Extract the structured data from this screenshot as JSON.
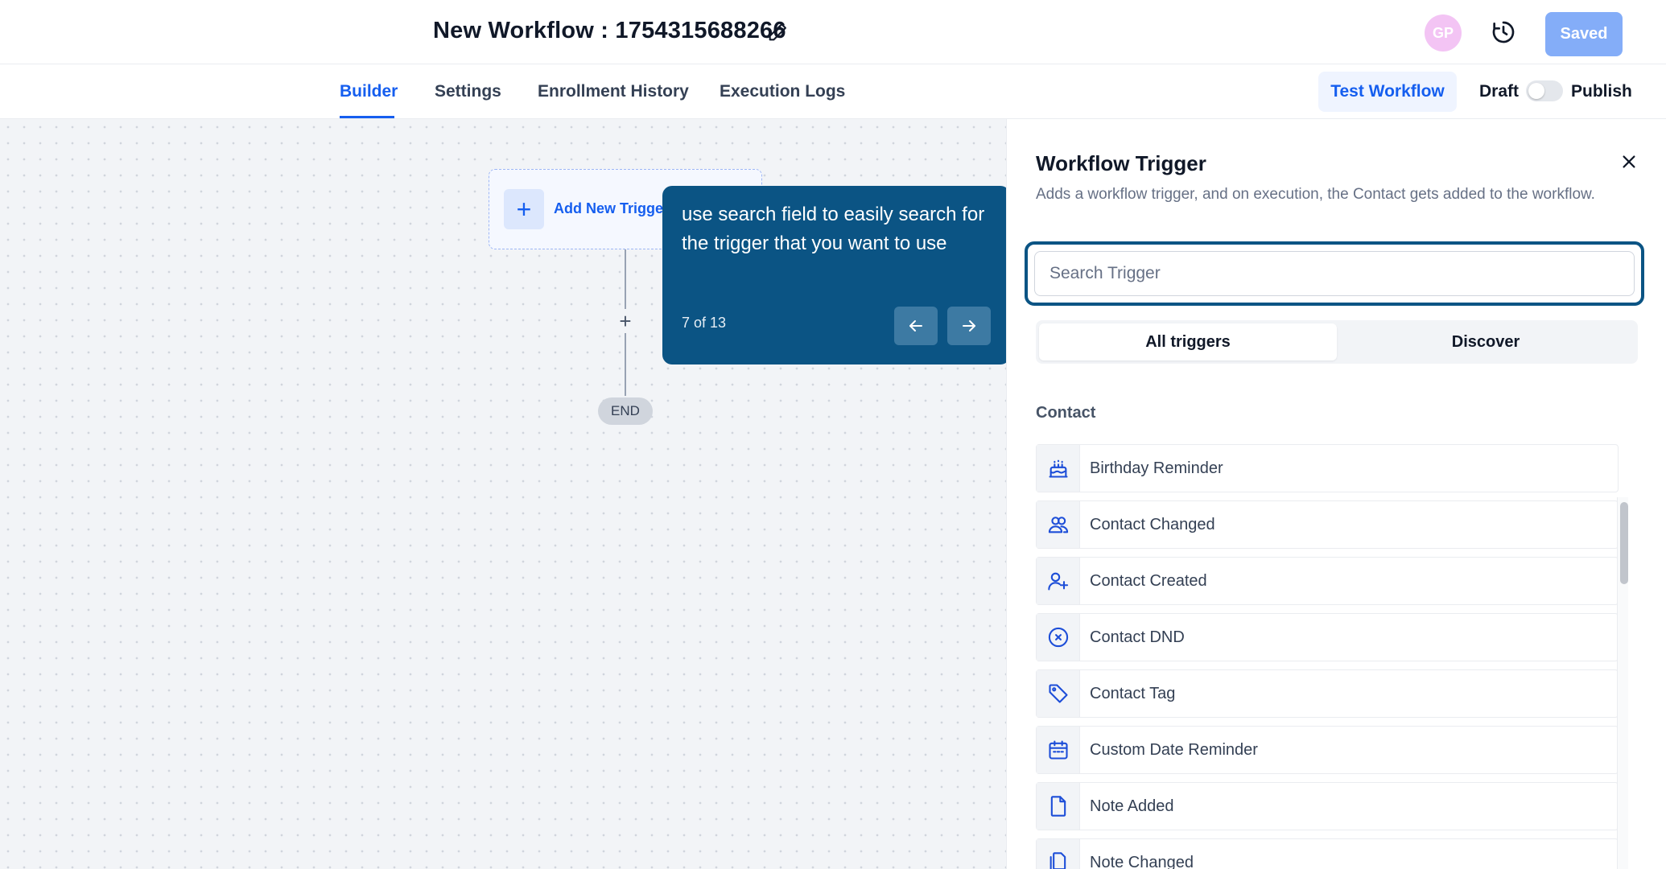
{
  "header": {
    "title": "New Workflow : 1754315688266",
    "avatar_initials": "GP",
    "saved_label": "Saved"
  },
  "tabs": [
    {
      "label": "Builder",
      "active": true
    },
    {
      "label": "Settings",
      "active": false
    },
    {
      "label": "Enrollment History",
      "active": false
    },
    {
      "label": "Execution Logs",
      "active": false
    }
  ],
  "actions": {
    "test_label": "Test Workflow",
    "draft_label": "Draft",
    "publish_label": "Publish",
    "publish_toggle_on": false
  },
  "canvas": {
    "trigger_label": "Add New Trigger",
    "end_label": "END"
  },
  "tooltip": {
    "text": "use search field to easily search for the trigger that you want to use",
    "step": "7 of 13"
  },
  "panel": {
    "title": "Workflow Trigger",
    "description": "Adds a workflow trigger, and on execution, the Contact gets added to the workflow.",
    "search_placeholder": "Search Trigger",
    "segments": [
      {
        "label": "All triggers",
        "active": true
      },
      {
        "label": "Discover",
        "active": false
      }
    ],
    "section": "Contact",
    "items": [
      {
        "label": "Birthday Reminder",
        "icon": "cake-icon"
      },
      {
        "label": "Contact Changed",
        "icon": "users-icon"
      },
      {
        "label": "Contact Created",
        "icon": "user-plus-icon"
      },
      {
        "label": "Contact DND",
        "icon": "x-circle-icon"
      },
      {
        "label": "Contact Tag",
        "icon": "tag-icon"
      },
      {
        "label": "Custom Date Reminder",
        "icon": "calendar-icon"
      },
      {
        "label": "Note Added",
        "icon": "file-icon"
      },
      {
        "label": "Note Changed",
        "icon": "files-icon"
      }
    ]
  },
  "colors": {
    "accent": "#155eef",
    "tooltip_bg": "#0b5484",
    "icon_blue": "#1d4ed8"
  }
}
